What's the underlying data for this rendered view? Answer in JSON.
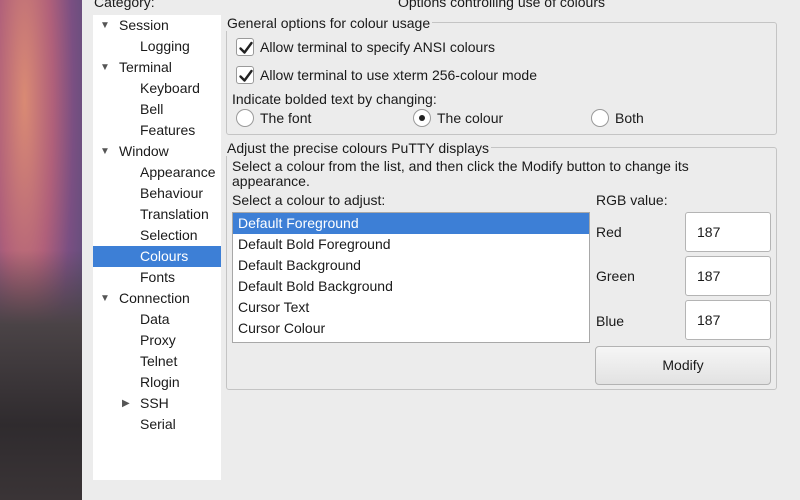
{
  "category_label": "Category:",
  "panel_title": "Options controlling use of colours",
  "tree": [
    {
      "label": "Session",
      "level": 0,
      "expanded": true
    },
    {
      "label": "Logging",
      "level": 1
    },
    {
      "label": "Terminal",
      "level": 0,
      "expanded": true
    },
    {
      "label": "Keyboard",
      "level": 1
    },
    {
      "label": "Bell",
      "level": 1
    },
    {
      "label": "Features",
      "level": 1
    },
    {
      "label": "Window",
      "level": 0,
      "expanded": true
    },
    {
      "label": "Appearance",
      "level": 1
    },
    {
      "label": "Behaviour",
      "level": 1
    },
    {
      "label": "Translation",
      "level": 1
    },
    {
      "label": "Selection",
      "level": 1
    },
    {
      "label": "Colours",
      "level": 1,
      "selected": true
    },
    {
      "label": "Fonts",
      "level": 1
    },
    {
      "label": "Connection",
      "level": 0,
      "expanded": true
    },
    {
      "label": "Data",
      "level": 1
    },
    {
      "label": "Proxy",
      "level": 1
    },
    {
      "label": "Telnet",
      "level": 1
    },
    {
      "label": "Rlogin",
      "level": 1
    },
    {
      "label": "SSH",
      "level": 1,
      "collapsed": true
    },
    {
      "label": "Serial",
      "level": 1
    }
  ],
  "general": {
    "title": "General options for colour usage",
    "ansi_label": "Allow terminal to specify ANSI colours",
    "ansi_checked": true,
    "xterm_label": "Allow terminal to use xterm 256-colour mode",
    "xterm_checked": true,
    "bold_label": "Indicate bolded text by changing:",
    "bold_options": [
      {
        "label": "The font",
        "selected": false
      },
      {
        "label": "The colour",
        "selected": true
      },
      {
        "label": "Both",
        "selected": false
      }
    ]
  },
  "adjust": {
    "title": "Adjust the precise colours PuTTY displays",
    "description": "Select a colour from the list, and then click the Modify button to change its appearance.",
    "list_label": "Select a colour to adjust:",
    "colours": [
      {
        "label": "Default Foreground",
        "selected": true
      },
      {
        "label": "Default Bold Foreground"
      },
      {
        "label": "Default Background"
      },
      {
        "label": "Default Bold Background"
      },
      {
        "label": "Cursor Text"
      },
      {
        "label": "Cursor Colour"
      }
    ],
    "rgb_label": "RGB value:",
    "red_label": "Red",
    "red_value": "187",
    "green_label": "Green",
    "green_value": "187",
    "blue_label": "Blue",
    "blue_value": "187",
    "modify_label": "Modify"
  },
  "colors": {
    "selection": "#3d7fd6",
    "window_bg": "#ececec"
  }
}
